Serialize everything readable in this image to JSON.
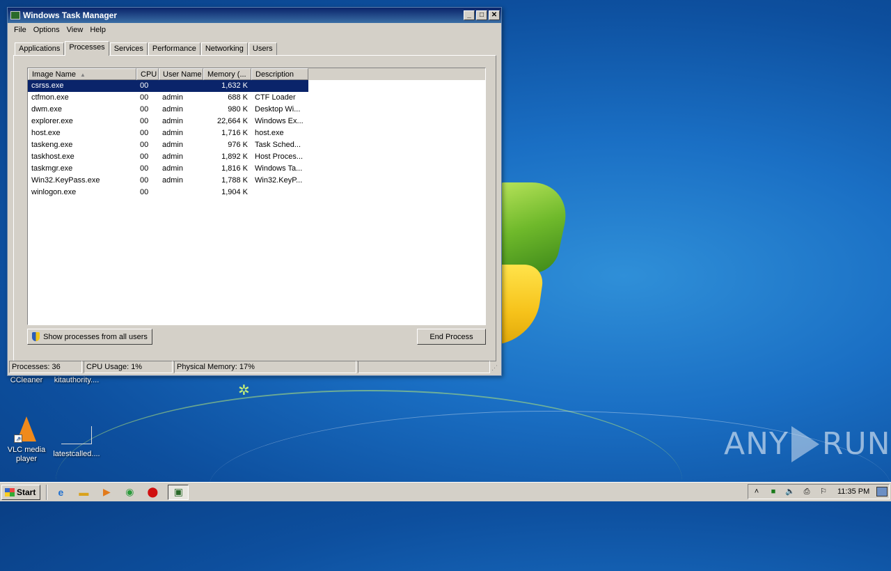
{
  "window": {
    "title": "Windows Task Manager",
    "controls": {
      "minimize": "_",
      "maximize": "□",
      "close": "✕"
    },
    "menu": [
      "File",
      "Options",
      "View",
      "Help"
    ],
    "tabs": [
      "Applications",
      "Processes",
      "Services",
      "Performance",
      "Networking",
      "Users"
    ],
    "active_tab": "Processes"
  },
  "processes": {
    "columns": [
      "Image Name",
      "CPU",
      "User Name",
      "Memory (...",
      "Description"
    ],
    "sort_indicator": "▲",
    "rows": [
      {
        "name": "csrss.exe",
        "cpu": "00",
        "user": "",
        "memory": "1,632 K",
        "desc": ""
      },
      {
        "name": "ctfmon.exe",
        "cpu": "00",
        "user": "admin",
        "memory": "688 K",
        "desc": "CTF Loader"
      },
      {
        "name": "dwm.exe",
        "cpu": "00",
        "user": "admin",
        "memory": "980 K",
        "desc": "Desktop Wi..."
      },
      {
        "name": "explorer.exe",
        "cpu": "00",
        "user": "admin",
        "memory": "22,664 K",
        "desc": "Windows Ex..."
      },
      {
        "name": "host.exe",
        "cpu": "00",
        "user": "admin",
        "memory": "1,716 K",
        "desc": "host.exe"
      },
      {
        "name": "taskeng.exe",
        "cpu": "00",
        "user": "admin",
        "memory": "976 K",
        "desc": "Task Sched..."
      },
      {
        "name": "taskhost.exe",
        "cpu": "00",
        "user": "admin",
        "memory": "1,892 K",
        "desc": "Host Proces..."
      },
      {
        "name": "taskmgr.exe",
        "cpu": "00",
        "user": "admin",
        "memory": "1,816 K",
        "desc": "Windows Ta..."
      },
      {
        "name": "Win32.KeyPass.exe",
        "cpu": "00",
        "user": "admin",
        "memory": "1,788 K",
        "desc": "Win32.KeyP..."
      },
      {
        "name": "winlogon.exe",
        "cpu": "00",
        "user": "",
        "memory": "1,904 K",
        "desc": ""
      }
    ],
    "selected_row": 0,
    "show_all_button": "Show processes from all users",
    "end_process_button": "End Process"
  },
  "status": {
    "processes": "Processes: 36",
    "cpu": "CPU Usage: 1%",
    "memory": "Physical Memory: 17%"
  },
  "desktop": {
    "icons": [
      {
        "label": "CCleaner",
        "icon": "ccleaner-icon"
      },
      {
        "label": "kitauthority....",
        "icon": "file-icon"
      },
      {
        "label": "VLC media player",
        "icon": "vlc-icon"
      },
      {
        "label": "latestcalled....",
        "icon": "file-icon"
      }
    ],
    "watermark": {
      "left": "ANY",
      "right": "RUN"
    }
  },
  "taskbar": {
    "start_label": "Start",
    "clock": "11:35 PM",
    "quick_launch": [
      "ie-icon",
      "explorer-icon",
      "media-player-icon",
      "chrome-icon",
      "opera-icon",
      "taskmgr-icon"
    ],
    "tray": [
      "chevron-up-icon",
      "network-icon",
      "volume-icon",
      "printer-icon",
      "flag-icon"
    ]
  }
}
